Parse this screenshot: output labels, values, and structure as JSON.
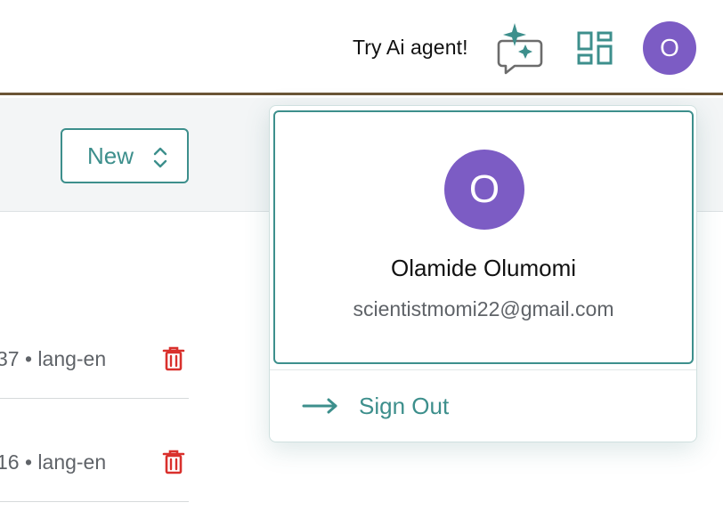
{
  "header": {
    "try_ai_label": "Try Ai agent!",
    "avatar_initial": "O"
  },
  "toolbar": {
    "sort_select_value": "New"
  },
  "list": {
    "items": [
      {
        "meta": "37 • lang-en"
      },
      {
        "meta": "16 • lang-en"
      }
    ]
  },
  "profile_menu": {
    "avatar_initial": "O",
    "name": "Olamide Olumomi",
    "email": "scientistmomi22@gmail.com",
    "sign_out_label": "Sign Out"
  },
  "colors": {
    "accent": "#3d8f8c",
    "avatar": "#7c5cc4",
    "danger": "#d9302c",
    "header_border": "#6b5536"
  },
  "icons": [
    "ai-agent-icon",
    "apps-grid-icon",
    "chevron-updown-icon",
    "trash-icon",
    "arrow-right-icon"
  ]
}
